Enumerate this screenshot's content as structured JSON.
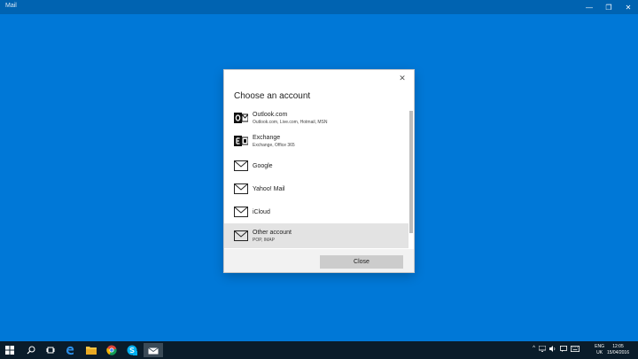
{
  "window": {
    "title": "Mail",
    "minimize": "—",
    "restore": "❐",
    "close": "✕"
  },
  "dialog": {
    "heading": "Choose an account",
    "close_glyph": "✕",
    "accounts": [
      {
        "name": "Outlook.com",
        "sub": "Outlook.com, Live.com, Hotmail, MSN",
        "icon": "outlook-icon"
      },
      {
        "name": "Exchange",
        "sub": "Exchange, Office 365",
        "icon": "exchange-icon"
      },
      {
        "name": "Google",
        "sub": "",
        "icon": "mail-icon"
      },
      {
        "name": "Yahoo! Mail",
        "sub": "",
        "icon": "mail-icon"
      },
      {
        "name": "iCloud",
        "sub": "",
        "icon": "mail-icon"
      },
      {
        "name": "Other account",
        "sub": "POP, IMAP",
        "icon": "mail-icon",
        "selected": true
      }
    ],
    "close_button": "Close"
  },
  "taskbar": {
    "language": "ENG",
    "region": "UK",
    "time": "12:05",
    "date": "15/04/2016"
  },
  "colors": {
    "desktop": "#0078d7",
    "titlebar": "#0063b1",
    "taskbar": "#0a1c2a"
  }
}
